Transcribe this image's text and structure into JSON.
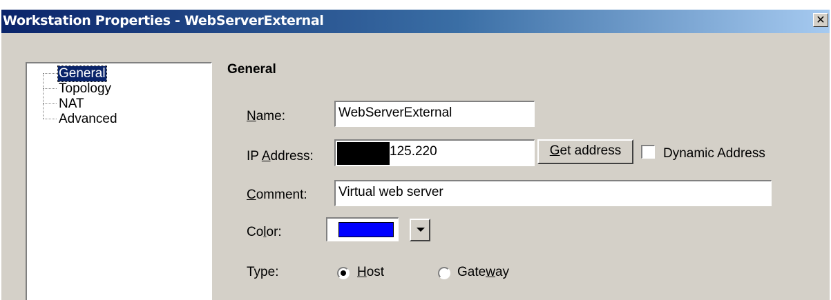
{
  "window": {
    "title": "Workstation Properties - WebServerExternal",
    "close_glyph": "✕"
  },
  "tree": {
    "items": [
      {
        "label": "General",
        "selected": true
      },
      {
        "label": "Topology",
        "selected": false
      },
      {
        "label": "NAT",
        "selected": false
      },
      {
        "label": "Advanced",
        "selected": false
      }
    ]
  },
  "general": {
    "section_title": "General",
    "name": {
      "mnemonic": "N",
      "rest": "ame:",
      "value": "WebServerExternal"
    },
    "ip": {
      "before": "IP ",
      "mnemonic": "A",
      "rest": "ddress:",
      "value_visible": "125.220",
      "redacted": true
    },
    "get_address": {
      "mnemonic": "G",
      "rest": "et address"
    },
    "dynamic_address": {
      "label": "Dynamic Address",
      "checked": false
    },
    "comment": {
      "mnemonic": "C",
      "rest": "omment:",
      "value": "Virtual web server"
    },
    "color": {
      "before": "Co",
      "mnemonic": "l",
      "rest": "or:",
      "value": "#0000ff"
    },
    "type": {
      "label": "Type:",
      "options": [
        {
          "before": "",
          "mnemonic": "H",
          "rest": "ost",
          "selected": true
        },
        {
          "before": "Gate",
          "mnemonic": "w",
          "rest": "ay",
          "selected": false
        }
      ]
    }
  }
}
